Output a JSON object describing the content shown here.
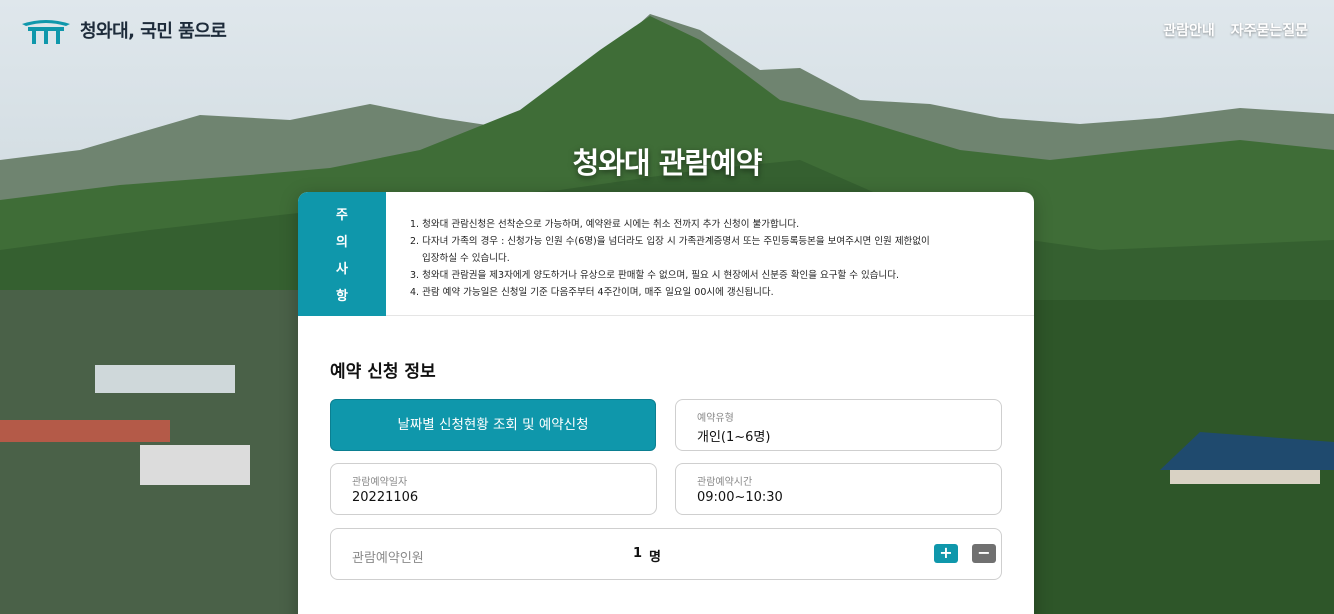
{
  "header": {
    "logo_text": "청와대, 국민 품으로",
    "nav": [
      "관람안내",
      "자주묻는질문"
    ]
  },
  "hero": {
    "title": "청와대 관람예약"
  },
  "notice": {
    "head_chars": [
      "주",
      "의",
      "사",
      "항"
    ],
    "items": [
      "1. 청와대 관람신청은 선착순으로 가능하며, 예약완료 시에는 취소 전까지 추가 신청이 불가합니다.",
      "2. 다자녀 가족의 경우 : 신청가능 인원 수(6명)을 넘더라도 입장 시 가족관계증명서 또는 주민등록등본을 보여주시면 인원 제한없이",
      "입장하실 수 있습니다.",
      "3. 청와대 관람권을 제3자에게 양도하거나 유상으로 판매할 수 없으며, 필요 시 현장에서 신분증 확인을 요구할 수 있습니다.",
      "4. 관람 예약 가능일은 신청일 기준 다음주부터 4주간이며, 매주 일요일 00시에 갱신됩니다."
    ]
  },
  "form": {
    "section_title": "예약 신청 정보",
    "primary_button": "날짜별 신청현황 조회 및 예약신청",
    "type": {
      "label": "예약유형",
      "value": "개인(1~6명)"
    },
    "date": {
      "label": "관람예약일자",
      "value": "20221106"
    },
    "time": {
      "label": "관람예약시간",
      "value": "09:00~10:30"
    },
    "people": {
      "label": "관람예약인원",
      "count": "1",
      "unit": "명",
      "plus": "+",
      "minus": "−"
    }
  },
  "colors": {
    "accent": "#0f97ab",
    "minus_button": "#707070"
  }
}
